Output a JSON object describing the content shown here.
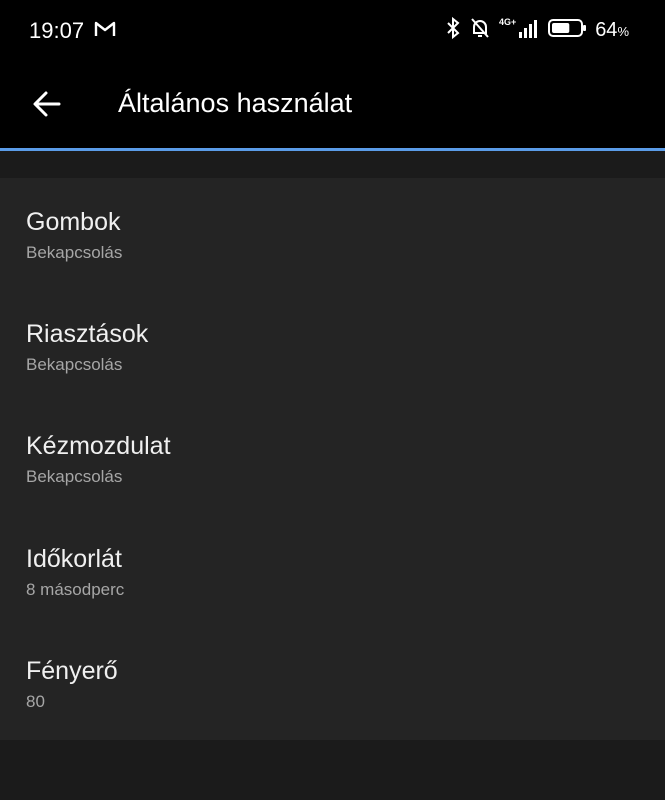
{
  "status_bar": {
    "time": "19:07",
    "battery_percent": "64",
    "battery_suffix": "%",
    "network": "4G+",
    "icons": [
      "gmail-icon",
      "bluetooth-icon",
      "bell-off-icon",
      "signal-icon",
      "battery-icon"
    ]
  },
  "header": {
    "title": "Általános használat",
    "back_icon": "arrow-left-icon"
  },
  "colors": {
    "accent": "#5b9ce8",
    "background": "#1b1b1b",
    "list_background": "#242424",
    "header_background": "#000000"
  },
  "settings": [
    {
      "label": "Gombok",
      "value": "Bekapcsolás"
    },
    {
      "label": "Riasztások",
      "value": "Bekapcsolás"
    },
    {
      "label": "Kézmozdulat",
      "value": "Bekapcsolás"
    },
    {
      "label": "Időkorlát",
      "value": "8 másodperc"
    },
    {
      "label": "Fényerő",
      "value": "80"
    }
  ]
}
